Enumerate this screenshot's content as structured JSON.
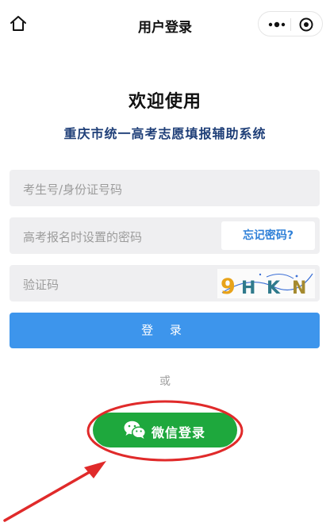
{
  "nav": {
    "title": "用户登录"
  },
  "heading": {
    "welcome": "欢迎使用",
    "system": "重庆市统一高考志愿填报辅助系统"
  },
  "form": {
    "candidate_placeholder": "考生号/身份证号码",
    "password_placeholder": "高考报名时设置的密码",
    "forgot_label": "忘记密码?",
    "captcha_placeholder": "验证码",
    "captcha_text": "9HKN",
    "login_label": "登 录"
  },
  "alt": {
    "or_label": "或",
    "wechat_label": "微信登录"
  },
  "colors": {
    "primary": "#3d95ec",
    "wechat": "#1ea83d",
    "annotation": "#e02a2a"
  },
  "icons": [
    "home-icon",
    "more-dots-icon",
    "close-target-icon",
    "wechat-icon",
    "red-arrow",
    "red-ellipse"
  ]
}
